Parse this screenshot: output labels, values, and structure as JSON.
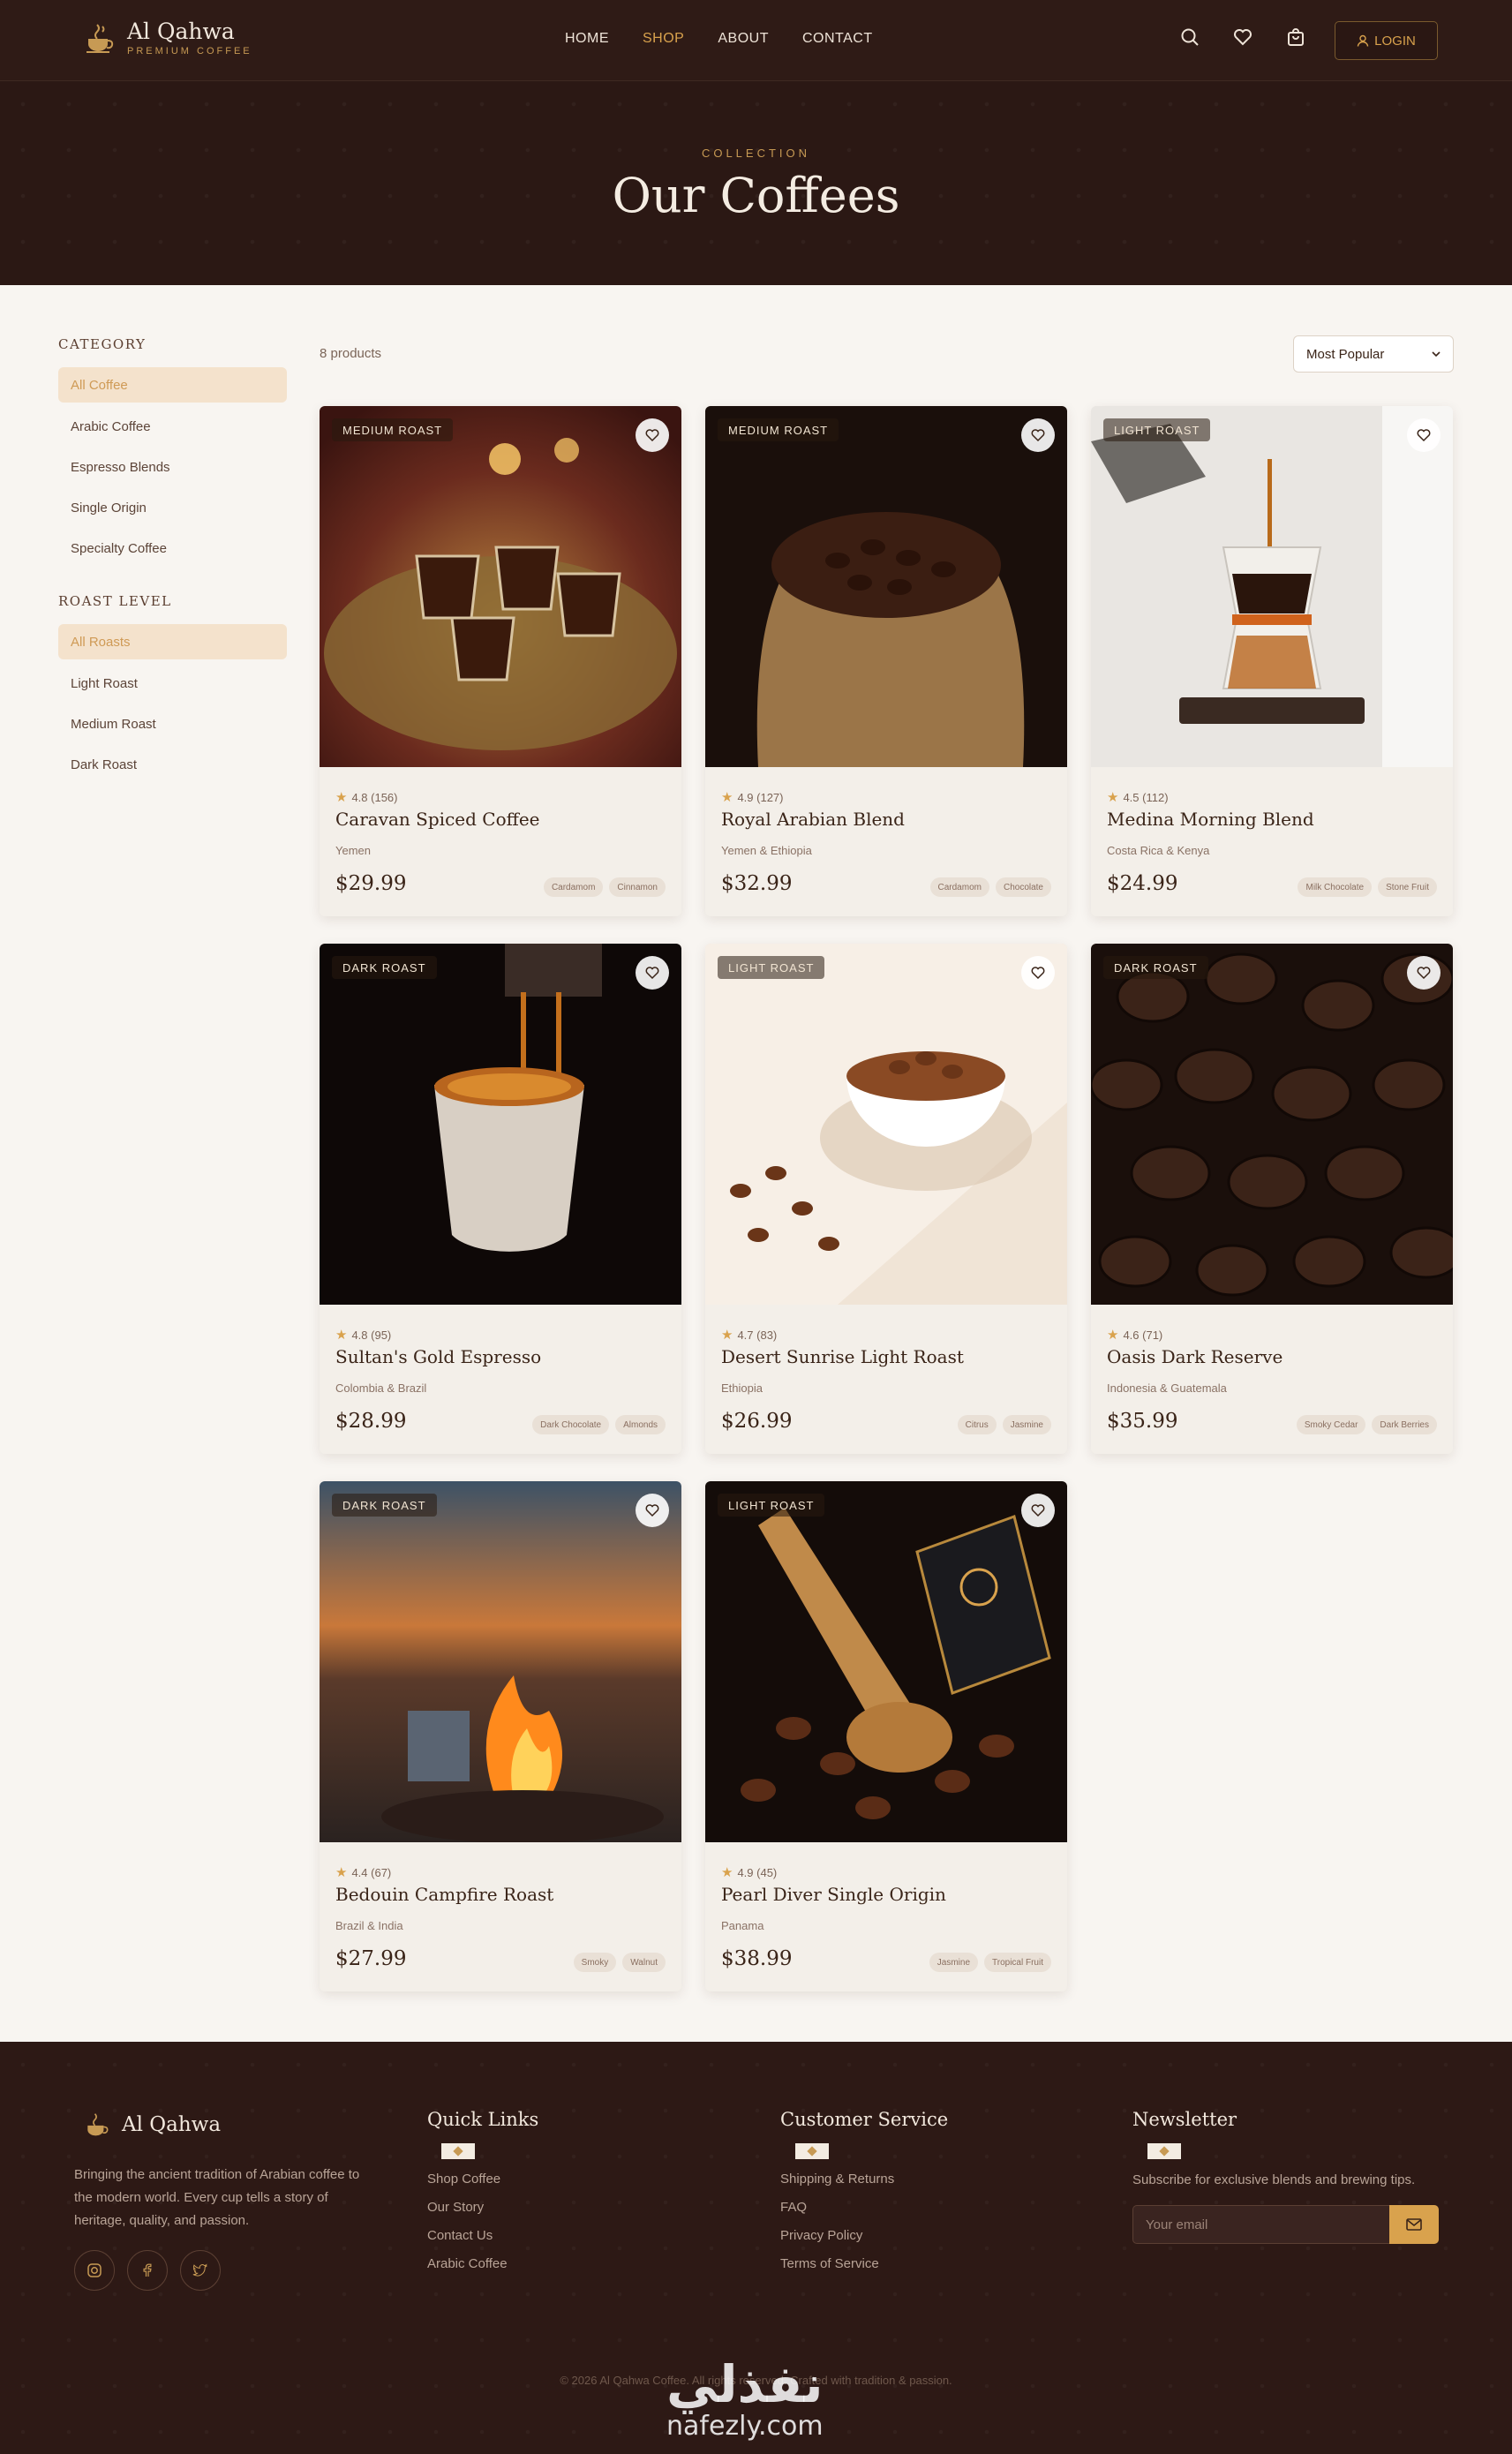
{
  "header": {
    "brand_name": "Al Qahwa",
    "brand_sub": "PREMIUM COFFEE",
    "nav": [
      "HOME",
      "SHOP",
      "ABOUT",
      "CONTACT"
    ],
    "nav_active": "SHOP",
    "icons": [
      "search-icon",
      "heart-icon",
      "bag-icon"
    ],
    "login_label": "LOGIN"
  },
  "hero": {
    "eyebrow": "COLLECTION",
    "title": "Our Coffees"
  },
  "sidebar": {
    "category_title": "CATEGORY",
    "categories": [
      "All Coffee",
      "Arabic Coffee",
      "Espresso Blends",
      "Single Origin",
      "Specialty Coffee"
    ],
    "roast_title": "ROAST LEVEL",
    "roasts": [
      "All Roasts",
      "Light Roast",
      "Medium Roast",
      "Dark Roast"
    ]
  },
  "toolbar": {
    "count": "8 products",
    "sort": "Most Popular"
  },
  "products": [
    {
      "badge": "MEDIUM ROAST",
      "rating": "4.8 (156)",
      "name": "Caravan Spiced Coffee",
      "origin": "Yemen",
      "price": "$29.99",
      "tags": [
        "Cardamom",
        "Cinnamon"
      ]
    },
    {
      "badge": "MEDIUM ROAST",
      "rating": "4.9 (127)",
      "name": "Royal Arabian Blend",
      "origin": "Yemen & Ethiopia",
      "price": "$32.99",
      "tags": [
        "Cardamom",
        "Chocolate"
      ]
    },
    {
      "badge": "LIGHT ROAST",
      "rating": "4.5 (112)",
      "name": "Medina Morning Blend",
      "origin": "Costa Rica & Kenya",
      "price": "$24.99",
      "tags": [
        "Milk Chocolate",
        "Stone Fruit"
      ]
    },
    {
      "badge": "DARK ROAST",
      "rating": "4.8 (95)",
      "name": "Sultan's Gold Espresso",
      "origin": "Colombia & Brazil",
      "price": "$28.99",
      "tags": [
        "Dark Chocolate",
        "Almonds"
      ]
    },
    {
      "badge": "LIGHT ROAST",
      "rating": "4.7 (83)",
      "name": "Desert Sunrise Light Roast",
      "origin": "Ethiopia",
      "price": "$26.99",
      "tags": [
        "Citrus",
        "Jasmine"
      ]
    },
    {
      "badge": "DARK ROAST",
      "rating": "4.6 (71)",
      "name": "Oasis Dark Reserve",
      "origin": "Indonesia & Guatemala",
      "price": "$35.99",
      "tags": [
        "Smoky Cedar",
        "Dark Berries"
      ]
    },
    {
      "badge": "DARK ROAST",
      "rating": "4.4 (67)",
      "name": "Bedouin Campfire Roast",
      "origin": "Brazil & India",
      "price": "$27.99",
      "tags": [
        "Smoky",
        "Walnut"
      ]
    },
    {
      "badge": "LIGHT ROAST",
      "rating": "4.9 (45)",
      "name": "Pearl Diver Single Origin",
      "origin": "Panama",
      "price": "$38.99",
      "tags": [
        "Jasmine",
        "Tropical Fruit"
      ]
    }
  ],
  "footer": {
    "brand_name": "Al Qahwa",
    "about": "Bringing the ancient tradition of Arabian coffee to the modern world. Every cup tells a story of heritage, quality, and passion.",
    "socials": [
      "instagram-icon",
      "facebook-icon",
      "twitter-icon"
    ],
    "quick_links_title": "Quick Links",
    "quick_links": [
      "Shop Coffee",
      "Our Story",
      "Contact Us",
      "Arabic Coffee"
    ],
    "service_title": "Customer Service",
    "service_links": [
      "Shipping & Returns",
      "FAQ",
      "Privacy Policy",
      "Terms of Service"
    ],
    "newsletter_title": "Newsletter",
    "newsletter_text": "Subscribe for exclusive blends and brewing tips.",
    "email_placeholder": "Your email",
    "copyright": "© 2026 Al Qahwa Coffee. All rights reserved. Crafted with tradition & passion.",
    "watermark_ar": "نفذلي",
    "watermark_en": "nafezly.com"
  }
}
